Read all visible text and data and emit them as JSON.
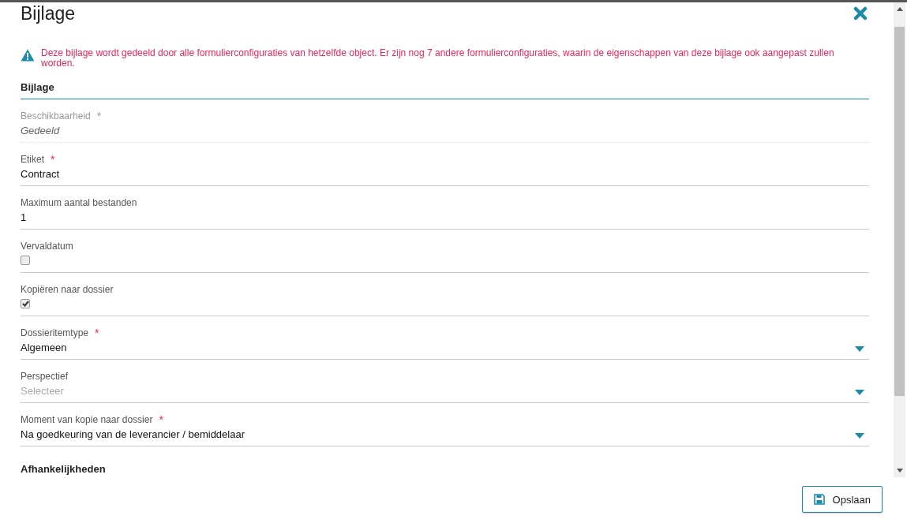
{
  "dialog": {
    "title": "Bijlage"
  },
  "warning": "Deze bijlage wordt gedeeld door alle formulierconfiguraties van hetzelfde object. Er zijn nog 7 andere formulierconfiguraties, waarin de eigenschappen van deze bijlage ook aangepast zullen worden.",
  "section": "Bijlage",
  "fields": [
    {
      "kind": "readonly",
      "label": "Beschikbaarheid",
      "required_mark": "*",
      "value": "Gedeeld"
    },
    {
      "kind": "text",
      "label": "Etiket",
      "required_mark": "*",
      "value": "Contract"
    },
    {
      "kind": "text",
      "label": "Maximum aantal bestanden",
      "value": "1"
    },
    {
      "kind": "checkbox",
      "label": "Vervaldatum",
      "checked": false
    },
    {
      "kind": "checkbox",
      "label": "Kopiëren naar dossier",
      "checked": true
    },
    {
      "kind": "select",
      "label": "Dossieritemtype",
      "required_mark": "*",
      "value": "Algemeen"
    },
    {
      "kind": "select",
      "label": "Perspectief",
      "placeholder": "Selecteer"
    },
    {
      "kind": "select",
      "label": "Moment van kopie naar dossier",
      "required_mark": "*",
      "value": "Na goedkeuring van de leverancier / bemiddelaar"
    }
  ],
  "section_2": "Afhankelijkheden",
  "save_button": "Opslaan"
}
